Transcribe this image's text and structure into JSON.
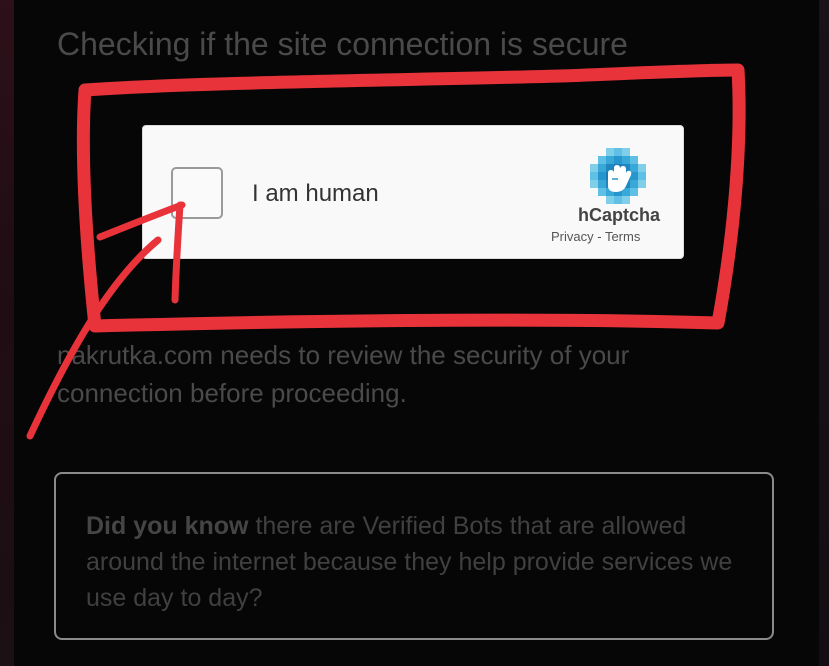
{
  "page": {
    "heading": "Checking if the site connection is secure",
    "notice": "nakrutka.com needs to review the security of your connection before proceeding."
  },
  "captcha": {
    "checkbox_label": "I am human",
    "brand": "hCaptcha",
    "privacy_link": "Privacy",
    "separator": " - ",
    "terms_link": "Terms"
  },
  "tip": {
    "bold_lead": "Did you know",
    "text": " there are Verified Bots that are allowed around the internet because they help provide services we use day to day?"
  },
  "colors": {
    "annotation": "#e8333a",
    "hcaptcha_logo": "#38a8d9"
  },
  "icons": {
    "captcha_logo": "hcaptcha-hand-icon"
  }
}
